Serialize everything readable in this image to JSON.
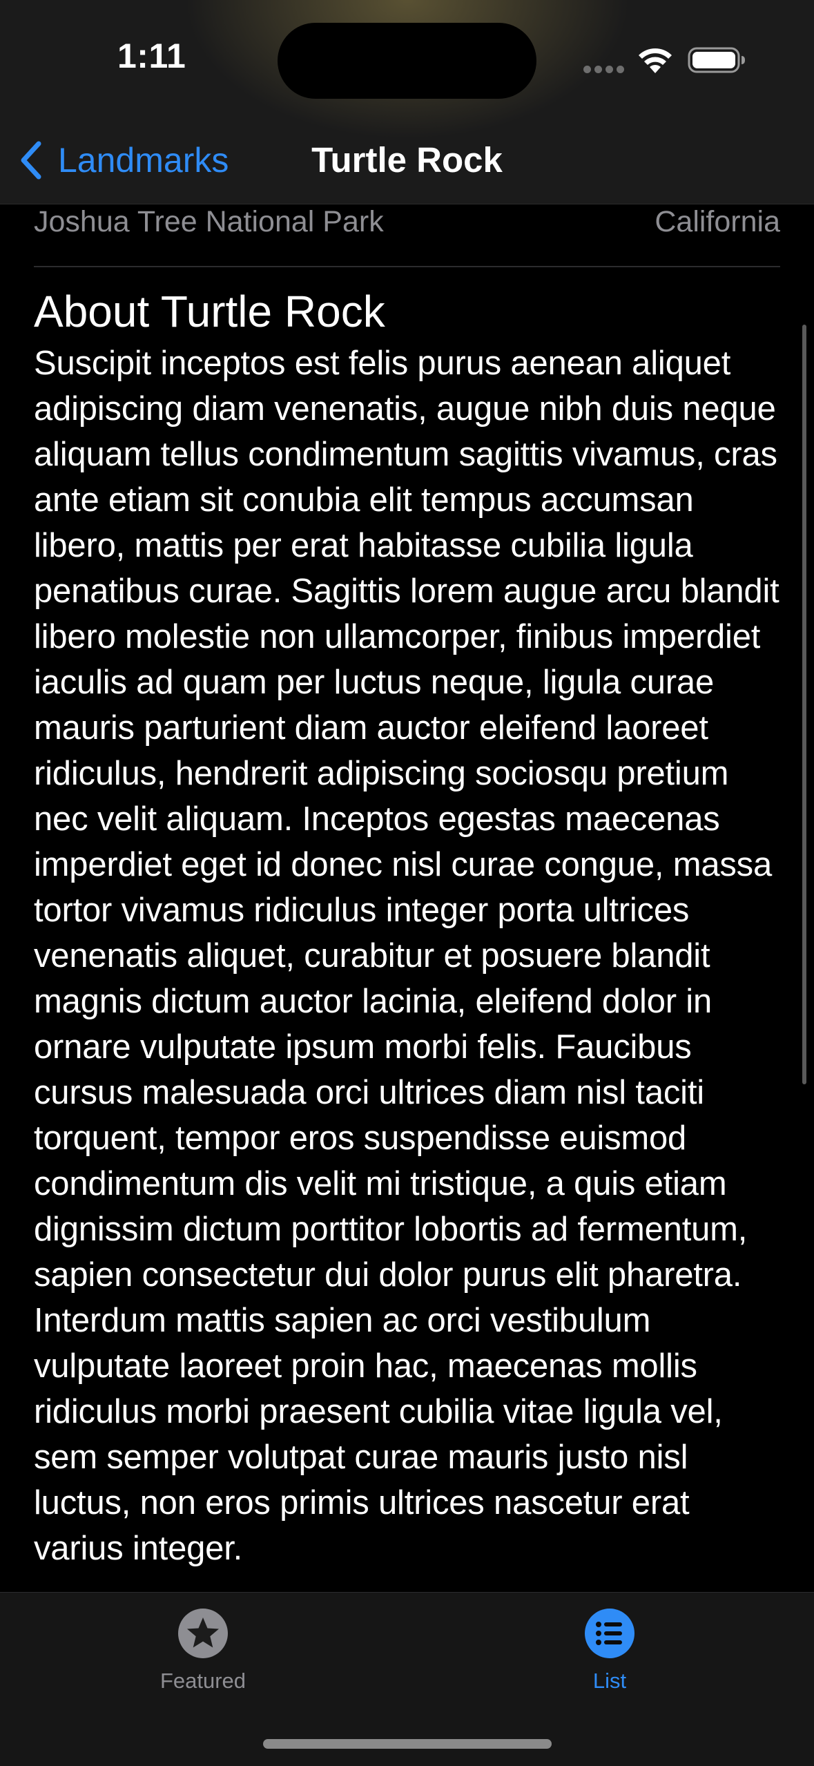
{
  "status_bar": {
    "time": "1:11",
    "icons": [
      "cellular-signal-icon",
      "wifi-icon",
      "battery-icon"
    ]
  },
  "nav": {
    "back_label": "Landmarks",
    "title": "Turtle Rock"
  },
  "landmark": {
    "park": "Joshua Tree National Park",
    "state": "California",
    "about_title": "About Turtle Rock",
    "description": "Suscipit inceptos est felis purus aenean aliquet adipiscing diam venenatis, augue nibh duis neque aliquam tellus condimentum sagittis vivamus, cras ante etiam sit conubia elit tempus accumsan libero, mattis per erat habitasse cubilia ligula penatibus curae. Sagittis lorem augue arcu blandit libero molestie non ullamcorper, finibus imperdiet iaculis ad quam per luctus neque, ligula curae mauris parturient diam auctor eleifend laoreet ridiculus, hendrerit adipiscing sociosqu pretium nec velit aliquam. Inceptos egestas maecenas imperdiet eget id donec nisl curae congue, massa tortor vivamus ridiculus integer porta ultrices venenatis aliquet, curabitur et posuere blandit magnis dictum auctor lacinia, eleifend dolor in ornare vulputate ipsum morbi felis. Faucibus cursus malesuada orci ultrices diam nisl taciti torquent, tempor eros suspendisse euismod condimentum dis velit mi tristique, a quis etiam dignissim dictum porttitor lobortis ad fermentum, sapien consectetur dui dolor purus elit pharetra. Interdum mattis sapien ac orci vestibulum vulputate laoreet proin hac, maecenas mollis ridiculus morbi praesent cubilia vitae ligula vel, sem semper volutpat curae mauris justo nisl luctus, non eros primis ultrices nascetur erat varius integer."
  },
  "tabs": [
    {
      "label": "Featured",
      "icon": "star-circle-icon",
      "selected": false
    },
    {
      "label": "List",
      "icon": "list-circle-icon",
      "selected": true
    }
  ],
  "colors": {
    "accent": "#2f8cf6",
    "secondary_text": "#8e8e93",
    "background": "#000000"
  }
}
